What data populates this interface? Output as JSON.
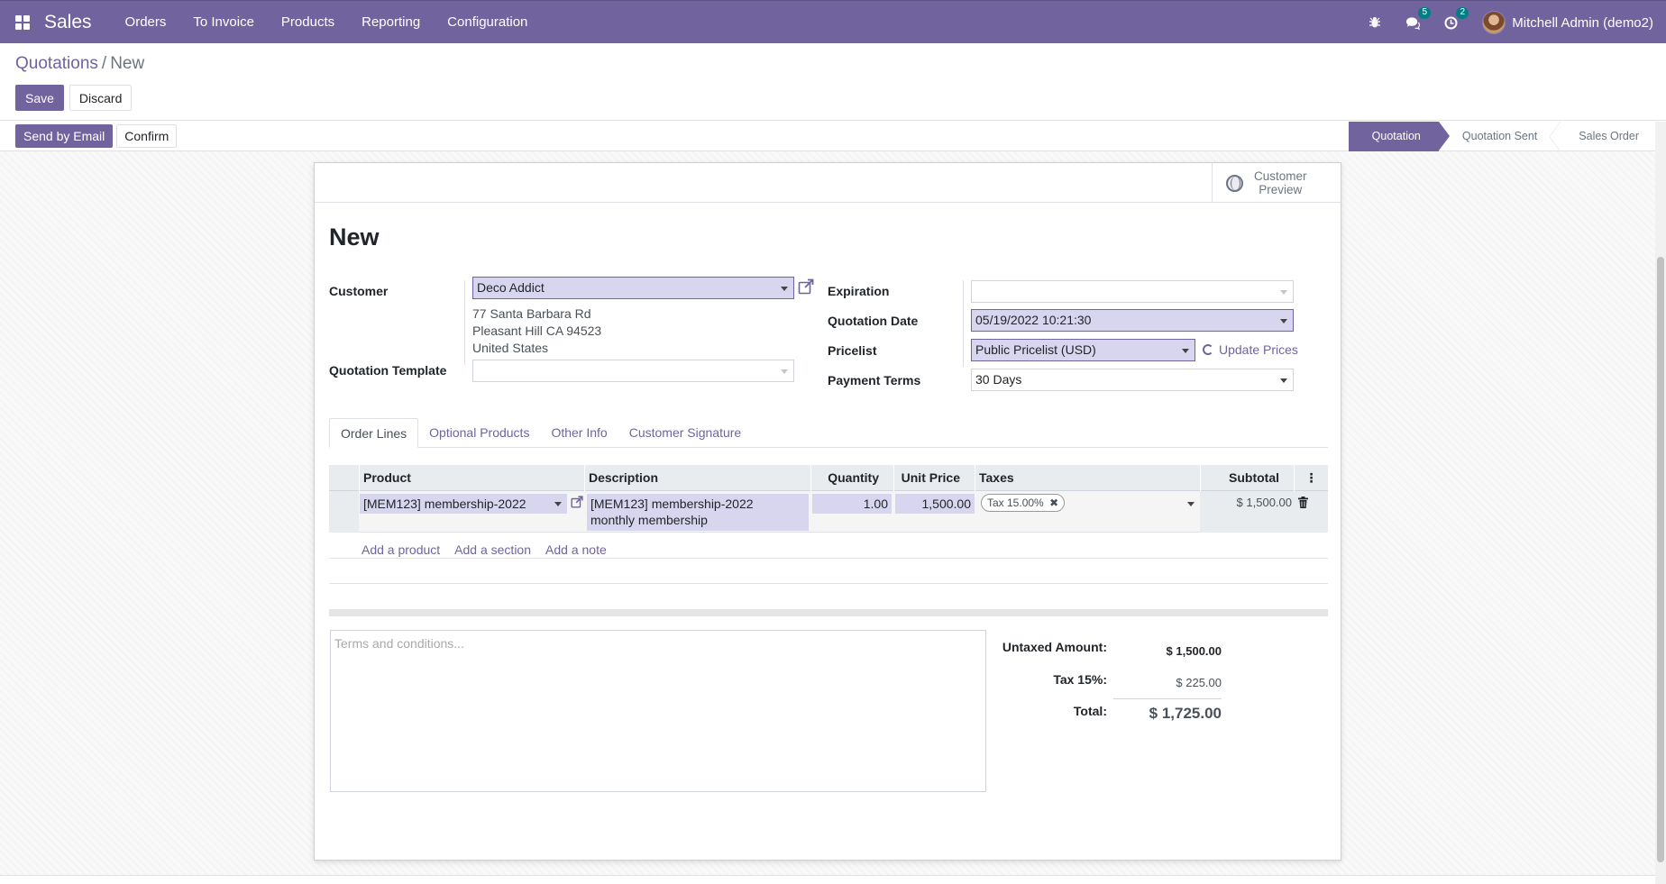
{
  "app": {
    "name": "Sales"
  },
  "nav": {
    "menu": [
      "Orders",
      "To Invoice",
      "Products",
      "Reporting",
      "Configuration"
    ],
    "messages_badge": "5",
    "activities_badge": "2",
    "user": "Mitchell Admin (demo2)"
  },
  "breadcrumb": {
    "parent": "Quotations",
    "separator": "/",
    "current": "New"
  },
  "control": {
    "save": "Save",
    "discard": "Discard"
  },
  "status_buttons": {
    "send_email": "Send by Email",
    "confirm": "Confirm"
  },
  "stages": [
    "Quotation",
    "Quotation Sent",
    "Sales Order"
  ],
  "active_stage": "Quotation",
  "smart_button": {
    "line1": "Customer",
    "line2": "Preview"
  },
  "record": {
    "title": "New"
  },
  "form": {
    "customer_label": "Customer",
    "customer_value": "Deco Addict",
    "address_line1": "77 Santa Barbara Rd",
    "address_line2": "Pleasant Hill CA 94523",
    "address_line3": "United States",
    "template_label": "Quotation Template",
    "template_value": "",
    "expiration_label": "Expiration",
    "expiration_value": "",
    "quotation_date_label": "Quotation Date",
    "quotation_date_value": "05/19/2022 10:21:30",
    "pricelist_label": "Pricelist",
    "pricelist_value": "Public Pricelist (USD)",
    "update_prices": "Update Prices",
    "payment_terms_label": "Payment Terms",
    "payment_terms_value": "30 Days"
  },
  "tabs": [
    "Order Lines",
    "Optional Products",
    "Other Info",
    "Customer Signature"
  ],
  "active_tab": "Order Lines",
  "table": {
    "headers": {
      "product": "Product",
      "description": "Description",
      "quantity": "Quantity",
      "unit_price": "Unit Price",
      "taxes": "Taxes",
      "subtotal": "Subtotal"
    },
    "rows": [
      {
        "product": "[MEM123] membership-2022",
        "description_line1": "[MEM123] membership-2022",
        "description_line2": "monthly membership",
        "quantity": "1.00",
        "unit_price": "1,500.00",
        "tax": "Tax 15.00%",
        "subtotal": "$ 1,500.00"
      }
    ],
    "add_product": "Add a product",
    "add_section": "Add a section",
    "add_note": "Add a note"
  },
  "terms": {
    "placeholder": "Terms and conditions..."
  },
  "totals": {
    "untaxed_label": "Untaxed Amount:",
    "untaxed_value": "$ 1,500.00",
    "tax_label": "Tax 15%:",
    "tax_value": "$ 225.00",
    "total_label": "Total:",
    "total_value": "$ 1,725.00"
  },
  "colors": {
    "brand": "#71639e",
    "badge": "#017e84",
    "field_highlight": "#d8d6ee"
  }
}
